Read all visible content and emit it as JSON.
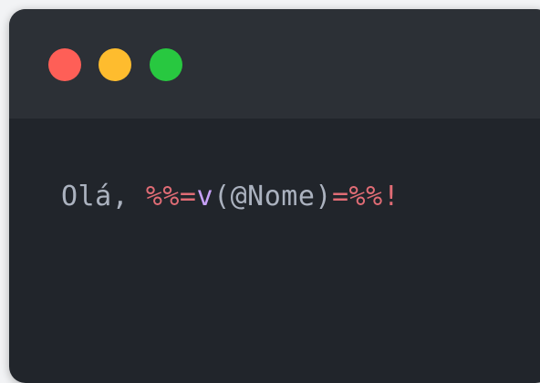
{
  "colors": {
    "close": "#fe5f57",
    "minimize": "#febc2e",
    "zoom": "#28c840",
    "plain_text": "#abb2bf",
    "delimiter": "#e06c75",
    "function": "#c6a0f6"
  },
  "window_controls": {
    "close_icon": "circle-red",
    "minimize_icon": "circle-yellow",
    "zoom_icon": "circle-green"
  },
  "code": {
    "greeting": "Olá, ",
    "open_delim": "%%=",
    "func_name": "v",
    "args": "(@Nome)",
    "close_delim": "=%%",
    "exclaim": "!"
  }
}
